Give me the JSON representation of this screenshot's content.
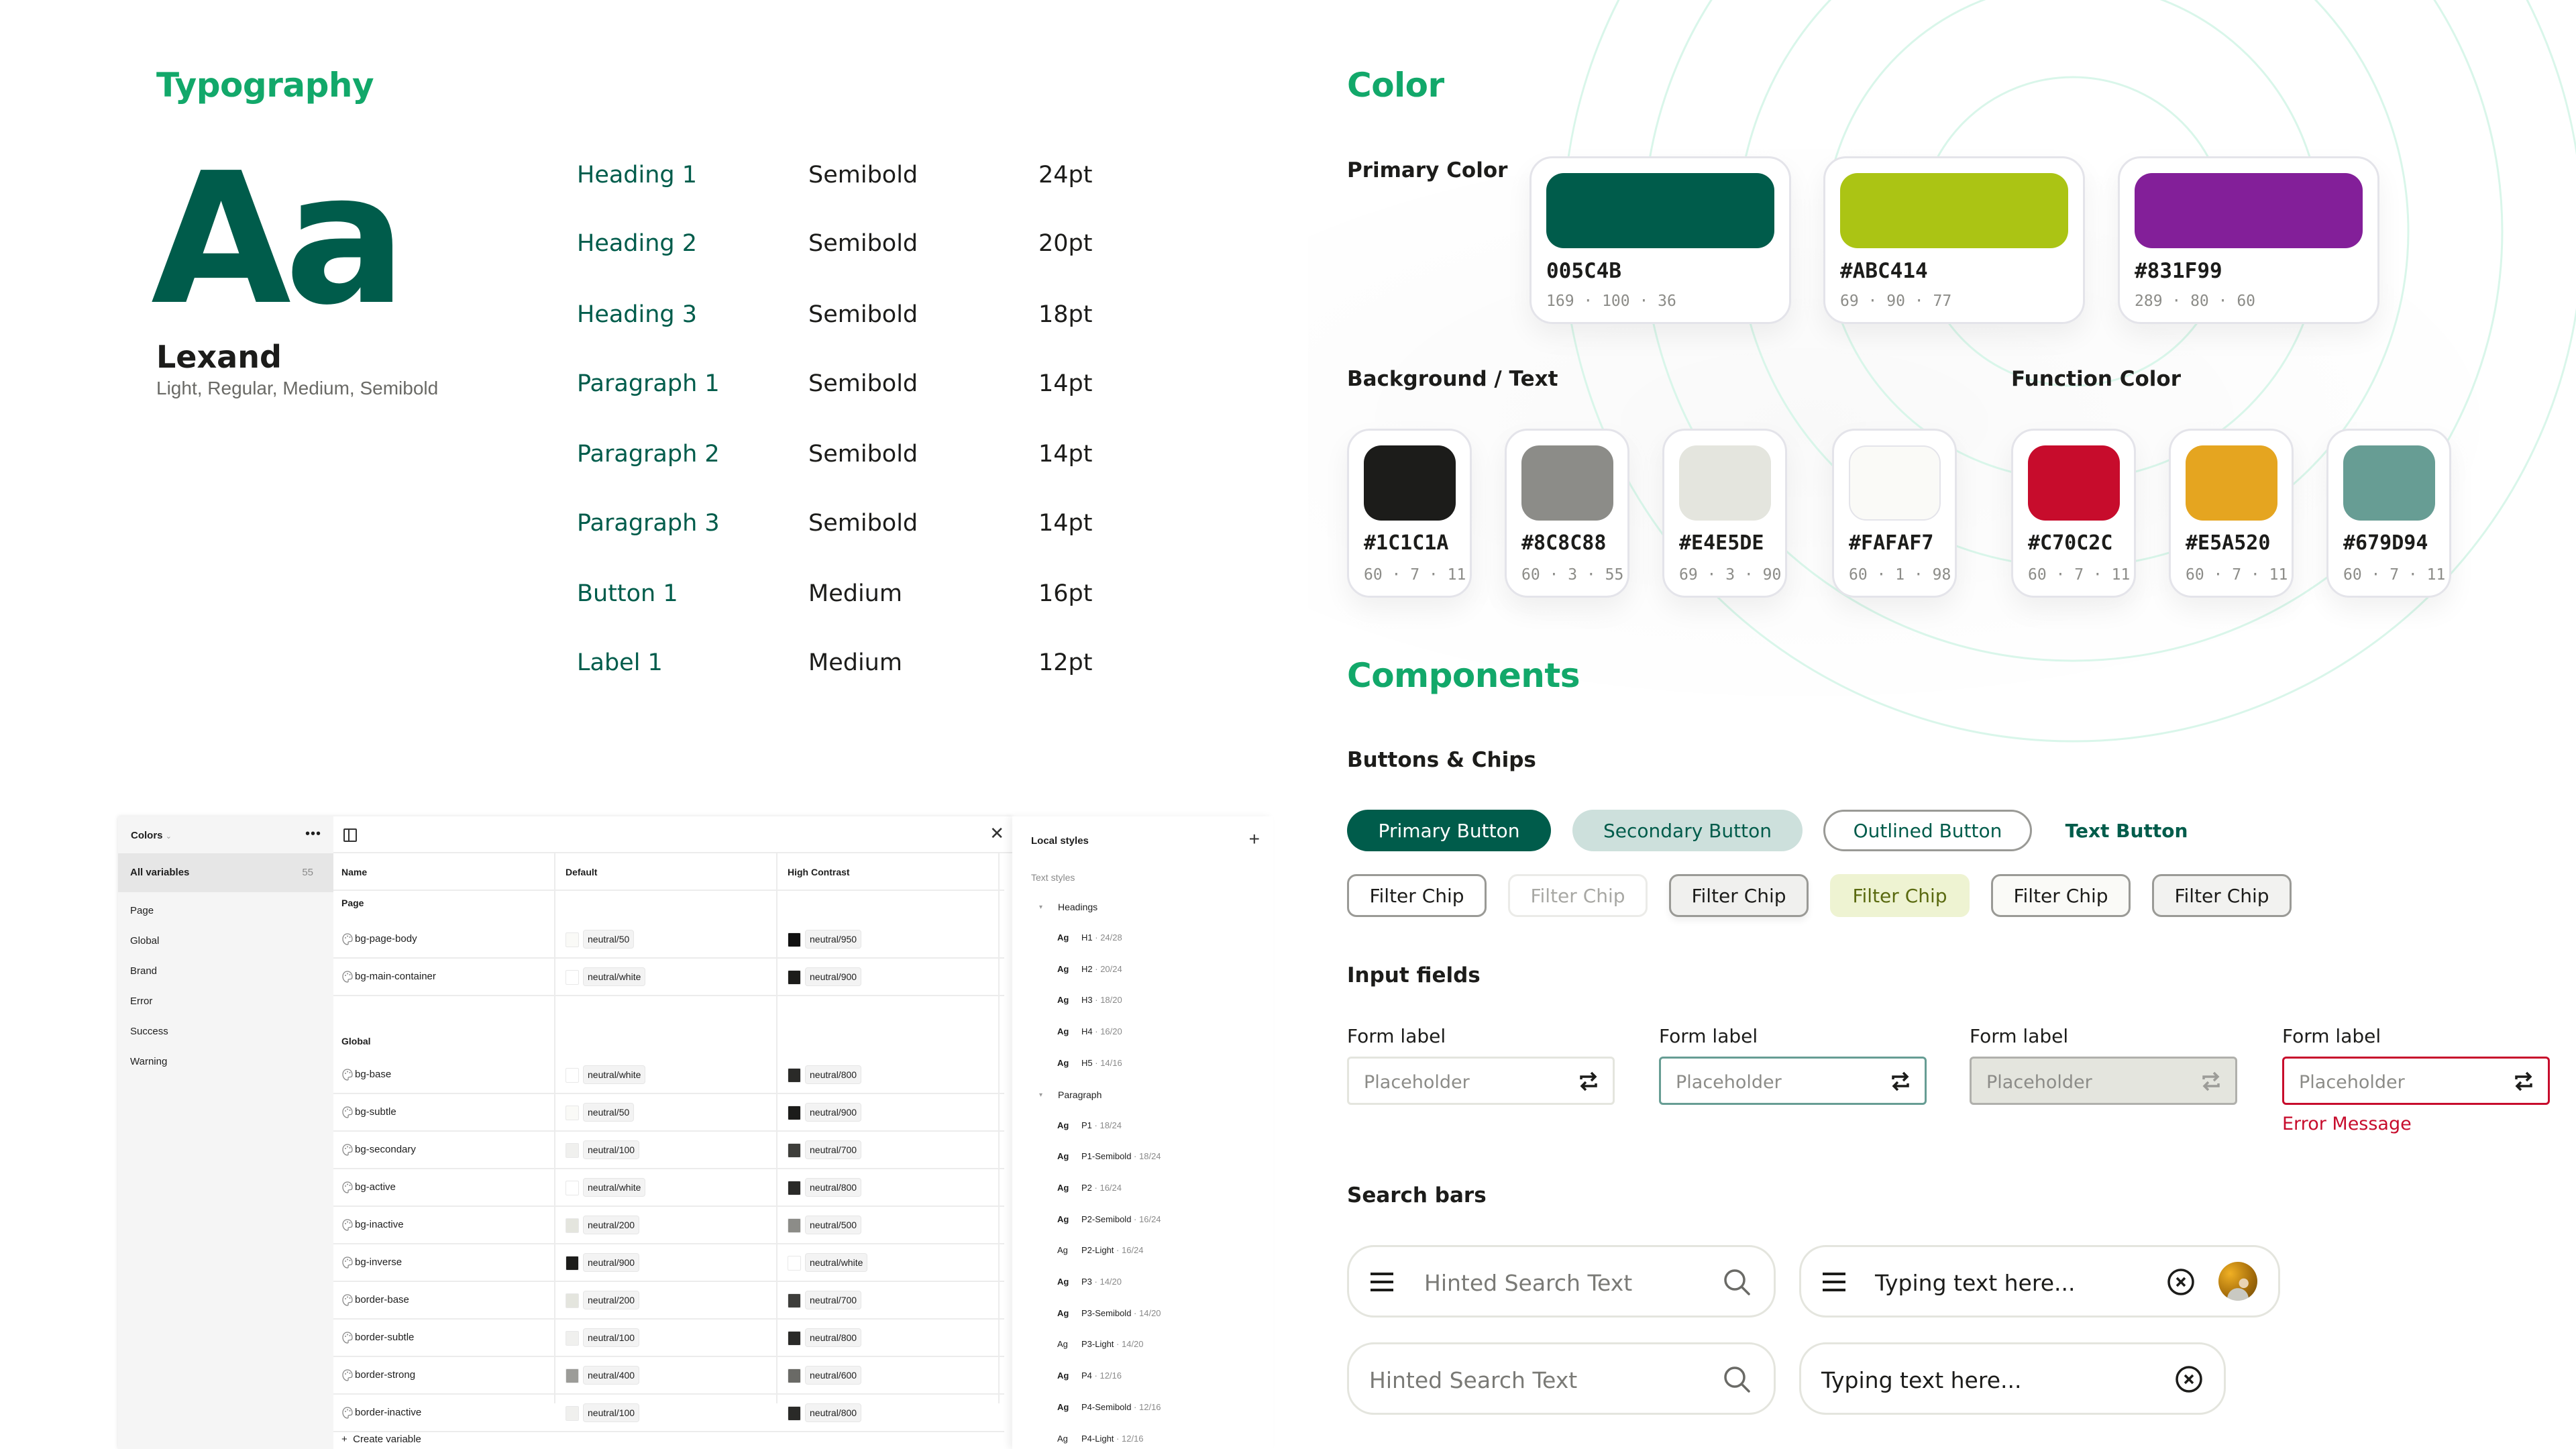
{
  "typography": {
    "title": "Typography",
    "specimen": "Aa",
    "font_name": "Lexand",
    "font_weights": "Light, Regular, Medium, Semibold",
    "styles": [
      {
        "name": "Heading 1",
        "weight": "Semibold",
        "size": "24pt"
      },
      {
        "name": "Heading 2",
        "weight": "Semibold",
        "size": "20pt"
      },
      {
        "name": "Heading 3",
        "weight": "Semibold",
        "size": "18pt"
      },
      {
        "name": "Paragraph 1",
        "weight": "Semibold",
        "size": "14pt"
      },
      {
        "name": "Paragraph 2",
        "weight": "Semibold",
        "size": "14pt"
      },
      {
        "name": "Paragraph 3",
        "weight": "Semibold",
        "size": "14pt"
      },
      {
        "name": "Button 1",
        "weight": "Medium",
        "size": "16pt"
      },
      {
        "name": "Label 1",
        "weight": "Medium",
        "size": "12pt"
      }
    ]
  },
  "color": {
    "title": "Color",
    "primary_label": "Primary Color",
    "primary": [
      {
        "hex": "005C4B",
        "swatch": "#005C4B",
        "values": "169 · 100 · 36"
      },
      {
        "hex": "#ABC414",
        "swatch": "#ABC414",
        "values": "69 · 90 · 77"
      },
      {
        "hex": "#831F99",
        "swatch": "#831F99",
        "values": "289 · 80 · 60"
      }
    ],
    "background_label": "Background / Text",
    "background": [
      {
        "hex": "#1C1C1A",
        "swatch": "#1C1C1A",
        "values": "60 · 7 · 11"
      },
      {
        "hex": "#8C8C88",
        "swatch": "#8C8C88",
        "values": "60 · 3 · 55"
      },
      {
        "hex": "#E4E5DE",
        "swatch": "#E4E5DE",
        "values": "69 · 3 · 90"
      },
      {
        "hex": "#FAFAF7",
        "swatch": "#FAFAF7",
        "values": "60 · 1 · 98"
      }
    ],
    "function_label": "Function Color",
    "function": [
      {
        "hex": "#C70C2C",
        "swatch": "#C70C2C",
        "values": "60 · 7 · 11"
      },
      {
        "hex": "#E5A520",
        "swatch": "#E5A520",
        "values": "60 · 7 · 11"
      },
      {
        "hex": "#679D94",
        "swatch": "#679D94",
        "values": "60 · 7 · 11"
      }
    ]
  },
  "components": {
    "title": "Components",
    "buttons_label": "Buttons & Chips",
    "buttons": {
      "primary": "Primary Button",
      "secondary": "Secondary Button",
      "outlined": "Outlined Button",
      "text": "Text Button"
    },
    "chips": [
      {
        "label": "Filter Chip",
        "state": "default"
      },
      {
        "label": "Filter Chip",
        "state": "disabled"
      },
      {
        "label": "Filter Chip",
        "state": "pressed"
      },
      {
        "label": "Filter Chip",
        "state": "selected"
      },
      {
        "label": "Filter Chip",
        "state": "hover"
      },
      {
        "label": "Filter Chip",
        "state": "focus"
      }
    ],
    "inputs_label": "Input fields",
    "inputs": [
      {
        "label": "Form label",
        "placeholder": "Placeholder",
        "state": "default"
      },
      {
        "label": "Form label",
        "placeholder": "Placeholder",
        "state": "focused"
      },
      {
        "label": "Form label",
        "placeholder": "Placeholder",
        "state": "disabled"
      },
      {
        "label": "Form label",
        "placeholder": "Placeholder",
        "state": "error"
      }
    ],
    "error_message": "Error Message",
    "search_label": "Search bars",
    "search": [
      {
        "text": "Hinted Search Text",
        "kind": "hint"
      },
      {
        "text": "Typing text here...",
        "kind": "typed"
      },
      {
        "text": "Hinted Search Text",
        "kind": "hint"
      },
      {
        "text": "Typing text here...",
        "kind": "typed"
      }
    ]
  },
  "variables_panel": {
    "collection": "Colors",
    "all_variables": "All variables",
    "count": "55",
    "groups": [
      "Page",
      "Global",
      "Brand",
      "Error",
      "Success",
      "Warning"
    ],
    "columns": [
      "Name",
      "Default",
      "High Contrast"
    ],
    "sections": [
      {
        "name": "Page",
        "rows": [
          {
            "name": "bg-page-body",
            "default": "neutral/50",
            "default_color": "#FAFAF7",
            "hc": "neutral/950",
            "hc_color": "#111111"
          },
          {
            "name": "bg-main-container",
            "default": "neutral/white",
            "default_color": "#FFFFFF",
            "hc": "neutral/900",
            "hc_color": "#1C1C1A"
          }
        ]
      },
      {
        "name": "Global",
        "rows": [
          {
            "name": "bg-base",
            "default": "neutral/white",
            "default_color": "#FFFFFF",
            "hc": "neutral/800",
            "hc_color": "#2A2A28"
          },
          {
            "name": "bg-subtle",
            "default": "neutral/50",
            "default_color": "#FAFAF7",
            "hc": "neutral/900",
            "hc_color": "#1C1C1A"
          },
          {
            "name": "bg-secondary",
            "default": "neutral/100",
            "default_color": "#F0F0EE",
            "hc": "neutral/700",
            "hc_color": "#3E3E3B"
          },
          {
            "name": "bg-active",
            "default": "neutral/white",
            "default_color": "#FFFFFF",
            "hc": "neutral/800",
            "hc_color": "#2A2A28"
          },
          {
            "name": "bg-inactive",
            "default": "neutral/200",
            "default_color": "#E4E5DE",
            "hc": "neutral/500",
            "hc_color": "#8C8C88"
          },
          {
            "name": "bg-inverse",
            "default": "neutral/900",
            "default_color": "#1C1C1A",
            "hc": "neutral/white",
            "hc_color": "#FFFFFF"
          },
          {
            "name": "border-base",
            "default": "neutral/200",
            "default_color": "#E4E5DE",
            "hc": "neutral/700",
            "hc_color": "#3E3E3B"
          },
          {
            "name": "border-subtle",
            "default": "neutral/100",
            "default_color": "#F0F0EE",
            "hc": "neutral/800",
            "hc_color": "#2A2A28"
          },
          {
            "name": "border-strong",
            "default": "neutral/400",
            "default_color": "#9C9C98",
            "hc": "neutral/600",
            "hc_color": "#6A6A66"
          },
          {
            "name": "border-inactive",
            "default": "neutral/100",
            "default_color": "#F0F0EE",
            "hc": "neutral/800",
            "hc_color": "#2A2A28"
          }
        ]
      }
    ],
    "create_label": "Create variable"
  },
  "local_styles": {
    "title": "Local styles",
    "section": "Text styles",
    "folders": [
      {
        "name": "Headings",
        "items": [
          {
            "sample": "Ag",
            "name": "H1",
            "meta": "24/28",
            "weight": "bold"
          },
          {
            "sample": "Ag",
            "name": "H2",
            "meta": "20/24",
            "weight": "bold"
          },
          {
            "sample": "Ag",
            "name": "H3",
            "meta": "18/20",
            "weight": "bold"
          },
          {
            "sample": "Ag",
            "name": "H4",
            "meta": "16/20",
            "weight": "bold"
          },
          {
            "sample": "Ag",
            "name": "H5",
            "meta": "14/16",
            "weight": "bold"
          }
        ]
      },
      {
        "name": "Paragraph",
        "items": [
          {
            "sample": "Ag",
            "name": "P1",
            "meta": "18/24",
            "weight": "bold"
          },
          {
            "sample": "Ag",
            "name": "P1-Semibold",
            "meta": "18/24",
            "weight": "bold"
          },
          {
            "sample": "Ag",
            "name": "P2",
            "meta": "16/24",
            "weight": "bold"
          },
          {
            "sample": "Ag",
            "name": "P2-Semibold",
            "meta": "16/24",
            "weight": "bold"
          },
          {
            "sample": "Ag",
            "name": "P2-Light",
            "meta": "16/24",
            "weight": "light"
          },
          {
            "sample": "Ag",
            "name": "P3",
            "meta": "14/20",
            "weight": "bold"
          },
          {
            "sample": "Ag",
            "name": "P3-Semibold",
            "meta": "14/20",
            "weight": "bold"
          },
          {
            "sample": "Ag",
            "name": "P3-Light",
            "meta": "14/20",
            "weight": "light"
          },
          {
            "sample": "Ag",
            "name": "P4",
            "meta": "12/16",
            "weight": "bold"
          },
          {
            "sample": "Ag",
            "name": "P4-Semibold",
            "meta": "12/16",
            "weight": "bold"
          },
          {
            "sample": "Ag",
            "name": "P4-Light",
            "meta": "12/16",
            "weight": "light"
          }
        ]
      }
    ]
  }
}
